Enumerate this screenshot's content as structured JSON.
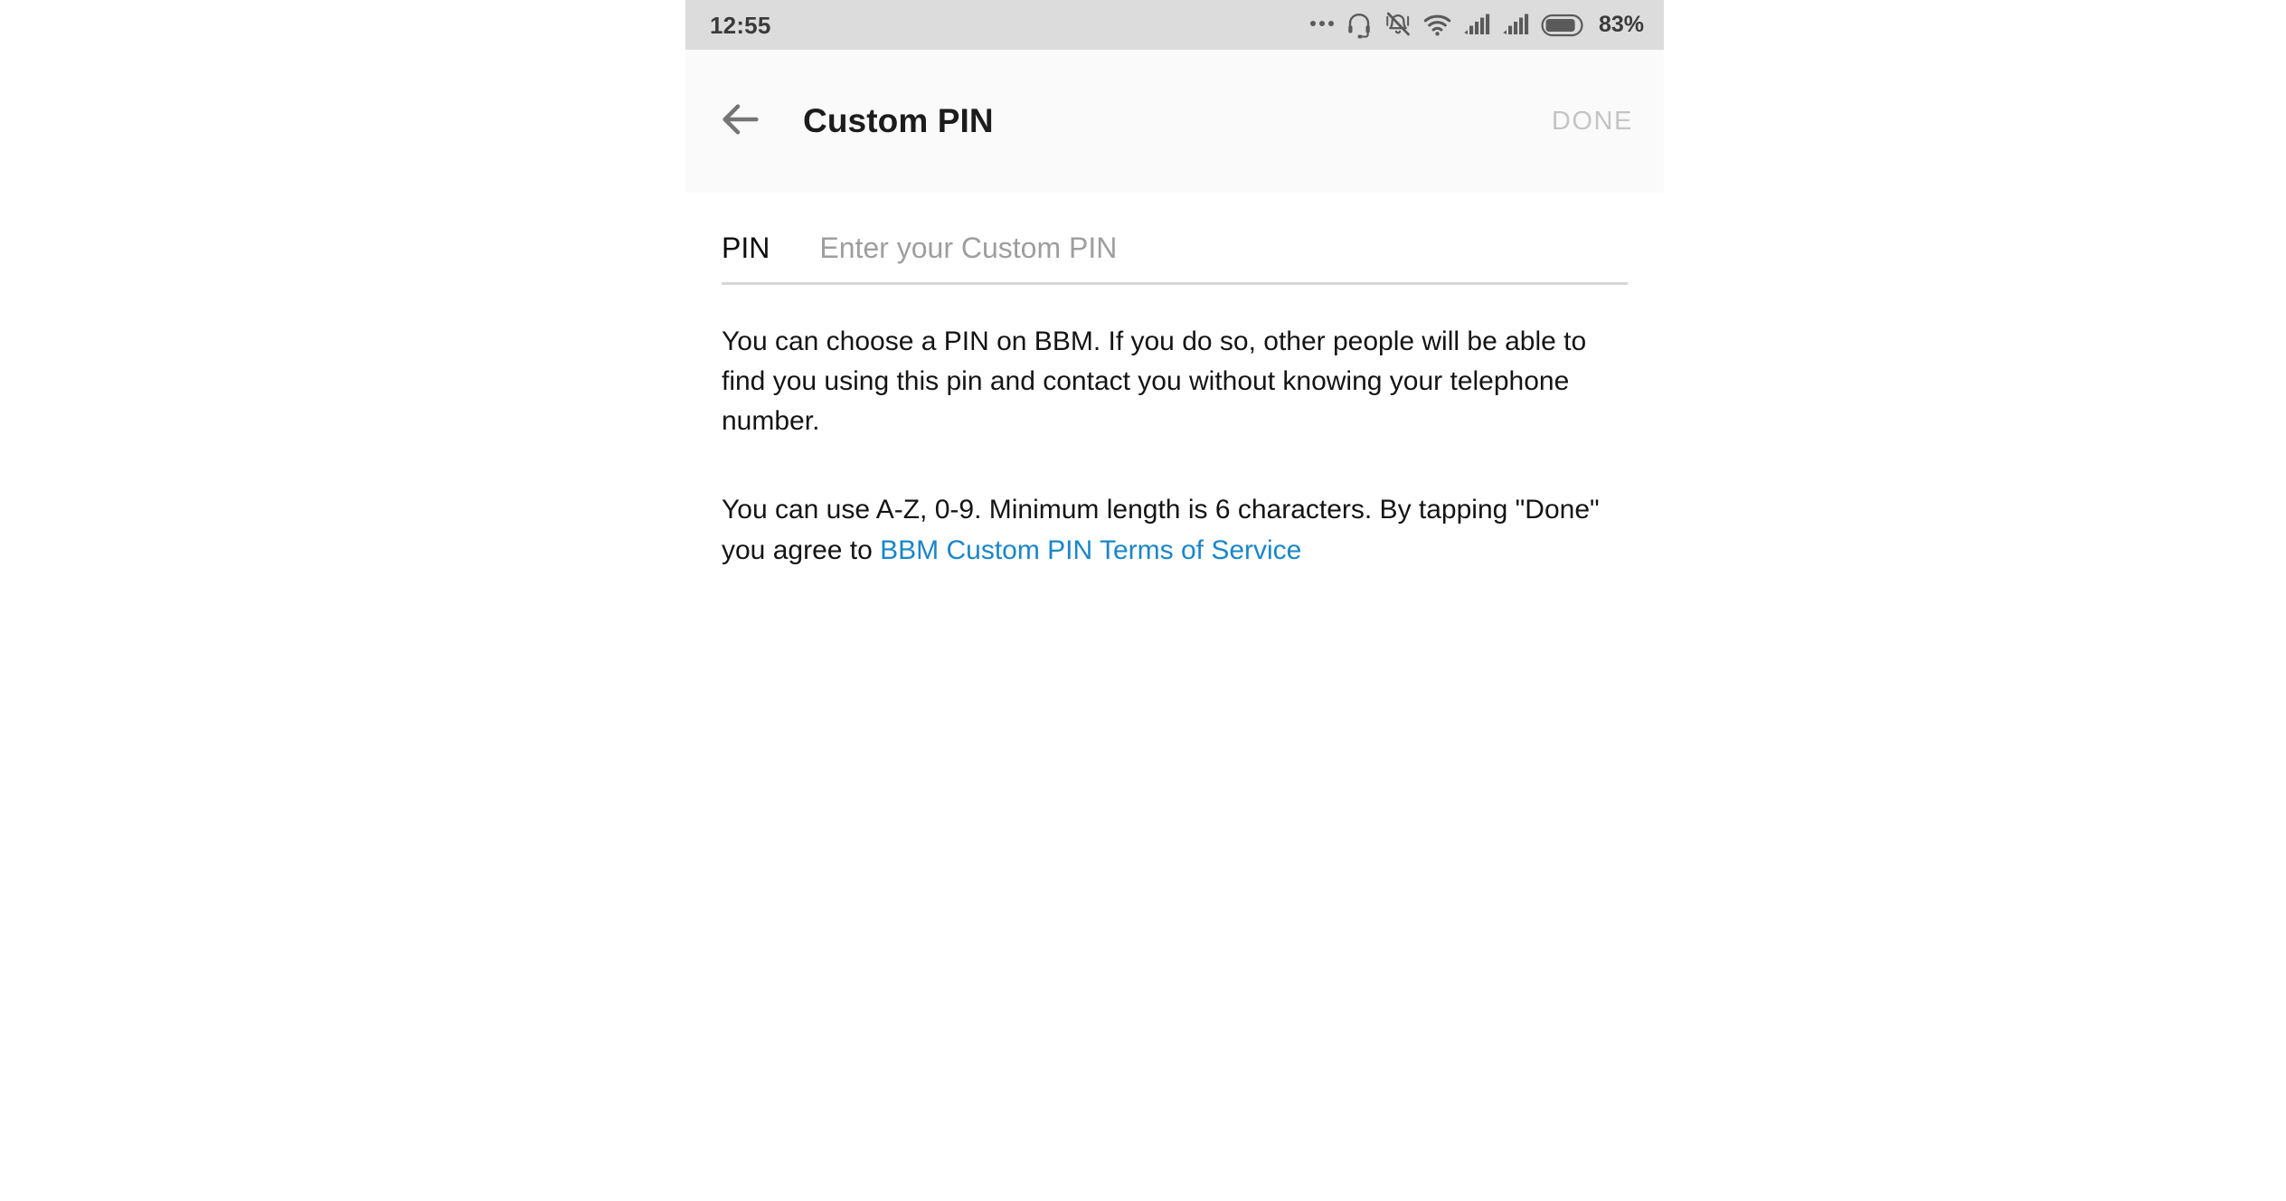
{
  "status_bar": {
    "clock": "12:55",
    "battery_percent": "83%",
    "icons": [
      "more-dots-icon",
      "headset-icon",
      "silent-vibrate-icon",
      "wifi-icon",
      "signal-bars-sim1-icon",
      "signal-bars-sim2-icon",
      "battery-icon"
    ],
    "colors": {
      "background": "#dcdcdc",
      "text": "#3a3a3a",
      "icon": "#5a5a5a"
    }
  },
  "app_bar": {
    "back_icon": "arrow-left-icon",
    "title": "Custom PIN",
    "done_label": "DONE",
    "done_enabled": false,
    "colors": {
      "background": "#fafafa",
      "title": "#1c1c1c",
      "done_disabled": "#c4c4c4",
      "back_icon": "#757575"
    }
  },
  "form": {
    "pin_label": "PIN",
    "pin_value": "",
    "pin_placeholder": "Enter your Custom PIN",
    "underline_color": "#d6d6d6"
  },
  "body": {
    "paragraph_one": "You can choose a PIN on BBM. If you do so, other people will be able to find you using this pin and contact you without knowing your telephone number.",
    "paragraph_two_before_link": "You can use A-Z, 0-9. Minimum length is 6 characters. By tapping \"Done\" you agree to ",
    "link_text": "BBM Custom PIN Terms of Service",
    "link_color": "#1a86c8",
    "text_color": "#141414"
  }
}
